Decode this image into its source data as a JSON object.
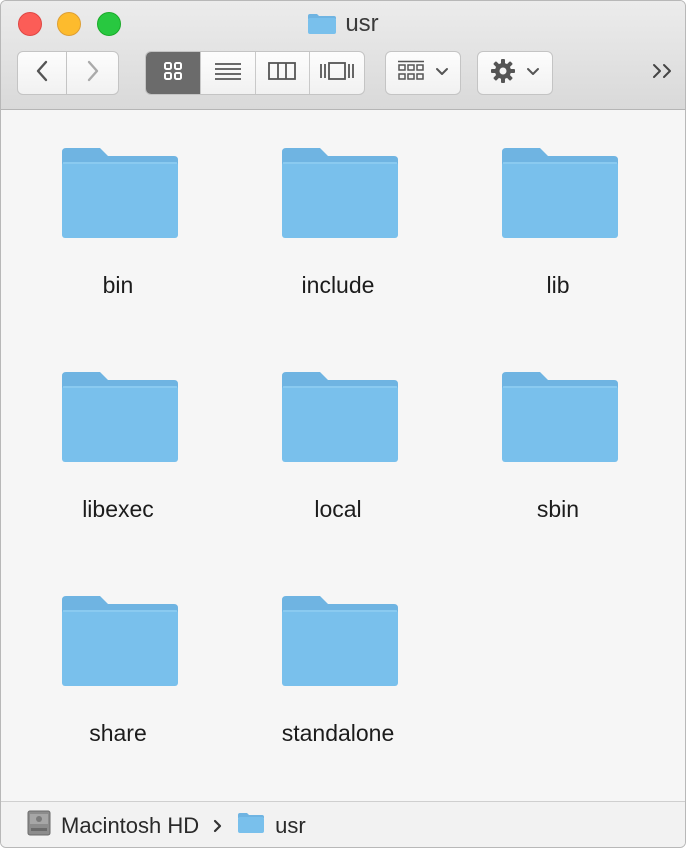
{
  "window": {
    "title": "usr",
    "title_icon": "folder-icon"
  },
  "toolbar": {
    "back_icon": "chevron-left-icon",
    "forward_icon": "chevron-right-icon",
    "view_modes": [
      {
        "name": "icon-view",
        "icon": "grid-icon",
        "active": true
      },
      {
        "name": "list-view",
        "icon": "list-icon",
        "active": false
      },
      {
        "name": "column-view",
        "icon": "columns-icon",
        "active": false
      },
      {
        "name": "gallery-view",
        "icon": "gallery-icon",
        "active": false
      }
    ],
    "group_icon": "group-grid-icon",
    "action_icon": "gear-icon",
    "overflow_icon": "double-chevron-right-icon"
  },
  "files": [
    {
      "name": "bin"
    },
    {
      "name": "include"
    },
    {
      "name": "lib"
    },
    {
      "name": "libexec"
    },
    {
      "name": "local"
    },
    {
      "name": "sbin"
    },
    {
      "name": "share"
    },
    {
      "name": "standalone"
    }
  ],
  "pathbar": {
    "segments": [
      {
        "label": "Macintosh HD",
        "icon": "hard-drive-icon"
      },
      {
        "label": "usr",
        "icon": "folder-icon"
      }
    ],
    "separator_icon": "chevron-right-icon"
  },
  "colors": {
    "folder_body": "#79c0ec",
    "folder_tab": "#6fb4e2",
    "active_segment": "#6b6b6b",
    "close": "#fc5d57",
    "minimize": "#fdbb2d",
    "zoom": "#28c840"
  }
}
